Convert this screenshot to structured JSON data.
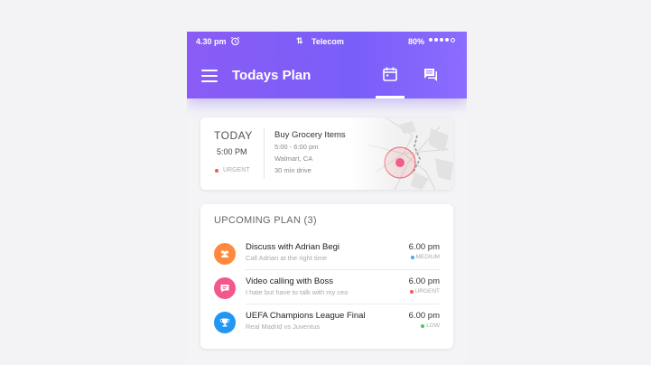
{
  "status_bar": {
    "time": "4.30 pm",
    "arrows": "⇅",
    "carrier": "Telecom",
    "battery": "80%"
  },
  "app_bar": {
    "title": "Todays Plan",
    "icons": [
      "menu-icon",
      "calendar-icon",
      "chat-icon"
    ],
    "accent_color": "#7c5cf6"
  },
  "today": {
    "label": "TODAY",
    "time": "5:00 PM",
    "priority": "URGENT",
    "task": {
      "title": "Buy Grocery Items",
      "time_range": "5:00 - 6:00 pm",
      "location": "Walmart, CA",
      "drive": "30 min drive"
    }
  },
  "upcoming": {
    "title": "UPCOMING PLAN (3)",
    "items": [
      {
        "title": "Discuss with Adrian Begi",
        "subtitle": "Call Adrian at the right time",
        "time": "6.00 pm",
        "priority": "MEDIUM",
        "priority_color": "#3fa9f5",
        "icon": "group-icon",
        "icon_color": "#ff8a3d"
      },
      {
        "title": "Video calling with Boss",
        "subtitle": "I hate but have to talk with my ceo",
        "time": "6.00 pm",
        "priority": "URGENT",
        "priority_color": "#f0575e",
        "icon": "chat-bubble-icon",
        "icon_color": "#f2588c"
      },
      {
        "title": "UEFA Champions League Final",
        "subtitle": "Real Madrid vs Juventus",
        "time": "6.00 pm",
        "priority": "LOW",
        "priority_color": "#4cc74f",
        "icon": "trophy-icon",
        "icon_color": "#2196f3"
      }
    ]
  }
}
